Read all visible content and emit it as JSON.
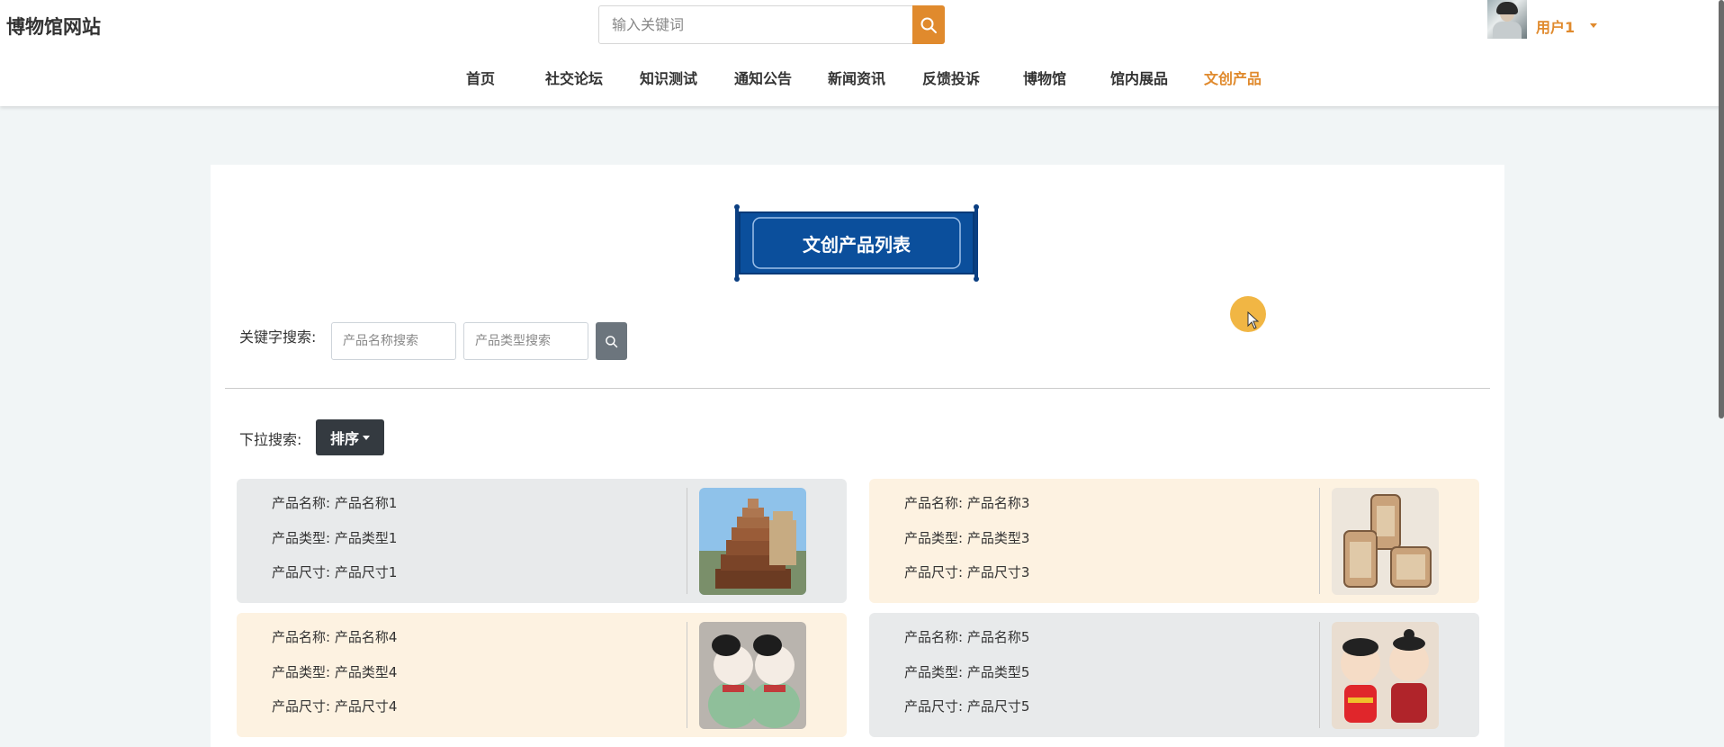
{
  "site_title": "博物馆网站",
  "header_search": {
    "placeholder": "输入关键词"
  },
  "user": {
    "name": "用户1"
  },
  "nav": [
    {
      "label": "首页"
    },
    {
      "label": "社交论坛"
    },
    {
      "label": "知识测试"
    },
    {
      "label": "通知公告"
    },
    {
      "label": "新闻资讯"
    },
    {
      "label": "反馈投诉"
    },
    {
      "label": "博物馆"
    },
    {
      "label": "馆内展品"
    },
    {
      "label": "文创产品",
      "active": true
    }
  ],
  "banner_title": "文创产品列表",
  "filter": {
    "keyword_label": "关键字搜索:",
    "name_placeholder": "产品名称搜索",
    "type_placeholder": "产品类型搜索",
    "dropdown_label": "下拉搜索:",
    "sort_label": "排序"
  },
  "products": [
    {
      "name": "产品名称: 产品名称1",
      "type": "产品类型: 产品类型1",
      "size": "产品尺寸: 产品尺寸1",
      "image": "pagoda-model"
    },
    {
      "name": "产品名称: 产品名称3",
      "type": "产品类型: 产品类型3",
      "size": "产品尺寸: 产品尺寸3",
      "image": "wooden-frames"
    },
    {
      "name": "产品名称: 产品名称4",
      "type": "产品类型: 产品类型4",
      "size": "产品尺寸: 产品尺寸4",
      "image": "tang-figurines"
    },
    {
      "name": "产品名称: 产品名称5",
      "type": "产品类型: 产品类型5",
      "size": "产品尺寸: 产品尺寸5",
      "image": "doll-figurines"
    }
  ],
  "colors": {
    "accent": "#e08a2d",
    "banner_blue": "#0b4f9c",
    "card_gray": "#e8eaeb",
    "card_cream": "#fdf2e1"
  }
}
